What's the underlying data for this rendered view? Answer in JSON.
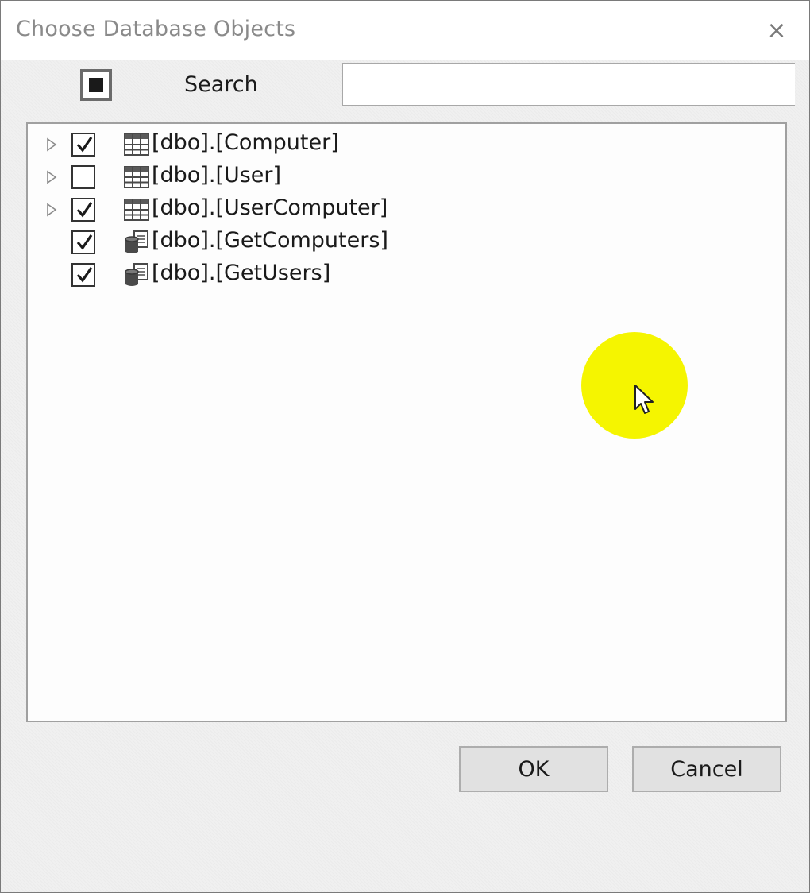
{
  "dialog": {
    "title": "Choose Database Objects",
    "close_symbol": "×"
  },
  "toolbar": {
    "select_all_state": "indeterminate",
    "search_label": "Search",
    "search_value": "",
    "search_placeholder": ""
  },
  "tree": {
    "items": [
      {
        "label": "[dbo].[Computer]",
        "checked": true,
        "expandable": true,
        "icon": "table-icon"
      },
      {
        "label": "[dbo].[User]",
        "checked": false,
        "expandable": true,
        "icon": "table-icon"
      },
      {
        "label": "[dbo].[UserComputer]",
        "checked": true,
        "expandable": true,
        "icon": "table-icon"
      },
      {
        "label": "[dbo].[GetComputers]",
        "checked": true,
        "expandable": false,
        "icon": "stored-procedure-icon"
      },
      {
        "label": "[dbo].[GetUsers]",
        "checked": true,
        "expandable": false,
        "icon": "stored-procedure-icon"
      }
    ]
  },
  "buttons": {
    "ok_label": "OK",
    "cancel_label": "Cancel"
  },
  "colors": {
    "cursor_highlight": "#f5f500",
    "button_face": "#e1e1e1",
    "title_text": "#8a8a8a"
  }
}
